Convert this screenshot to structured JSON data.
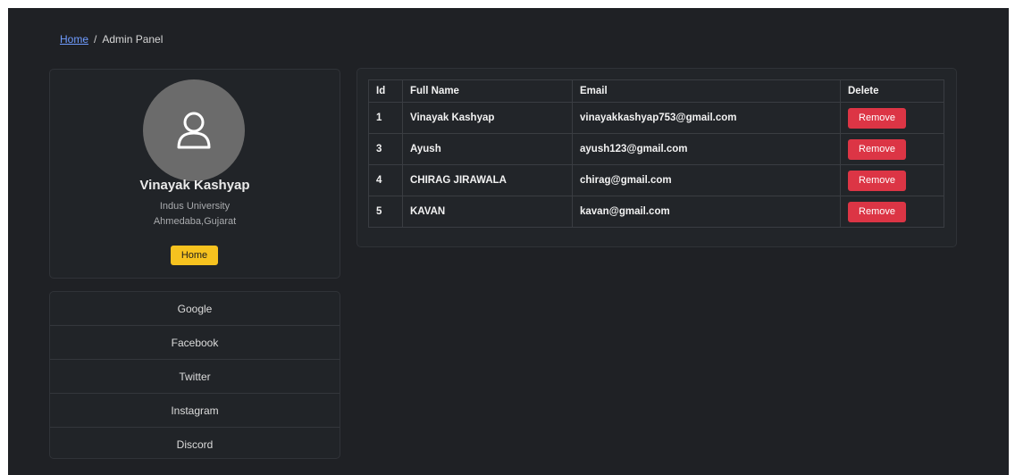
{
  "breadcrumb": {
    "home": "Home",
    "separator": "/",
    "current": "Admin Panel"
  },
  "profile": {
    "avatar_icon": "user-icon",
    "name": "Vinayak Kashyap",
    "line1": "Indus University",
    "line2": "Ahmedaba,Gujarat",
    "home_button": "Home"
  },
  "links": [
    "Google",
    "Facebook",
    "Twitter",
    "Instagram",
    "Discord"
  ],
  "table": {
    "headers": [
      "Id",
      "Full Name",
      "Email",
      "Delete"
    ],
    "rows": [
      {
        "id": "1",
        "name": "Vinayak Kashyap",
        "email": "vinayakkashyap753@gmail.com",
        "action": "Remove"
      },
      {
        "id": "3",
        "name": "Ayush",
        "email": "ayush123@gmail.com",
        "action": "Remove"
      },
      {
        "id": "4",
        "name": "CHIRAG JIRAWALA",
        "email": "chirag@gmail.com",
        "action": "Remove"
      },
      {
        "id": "5",
        "name": "KAVAN",
        "email": "kavan@gmail.com",
        "action": "Remove"
      }
    ]
  },
  "colors": {
    "background": "#1f2125",
    "accent_yellow": "#f6c21f",
    "danger_red": "#dc3545",
    "link_blue": "#6f9cff"
  }
}
